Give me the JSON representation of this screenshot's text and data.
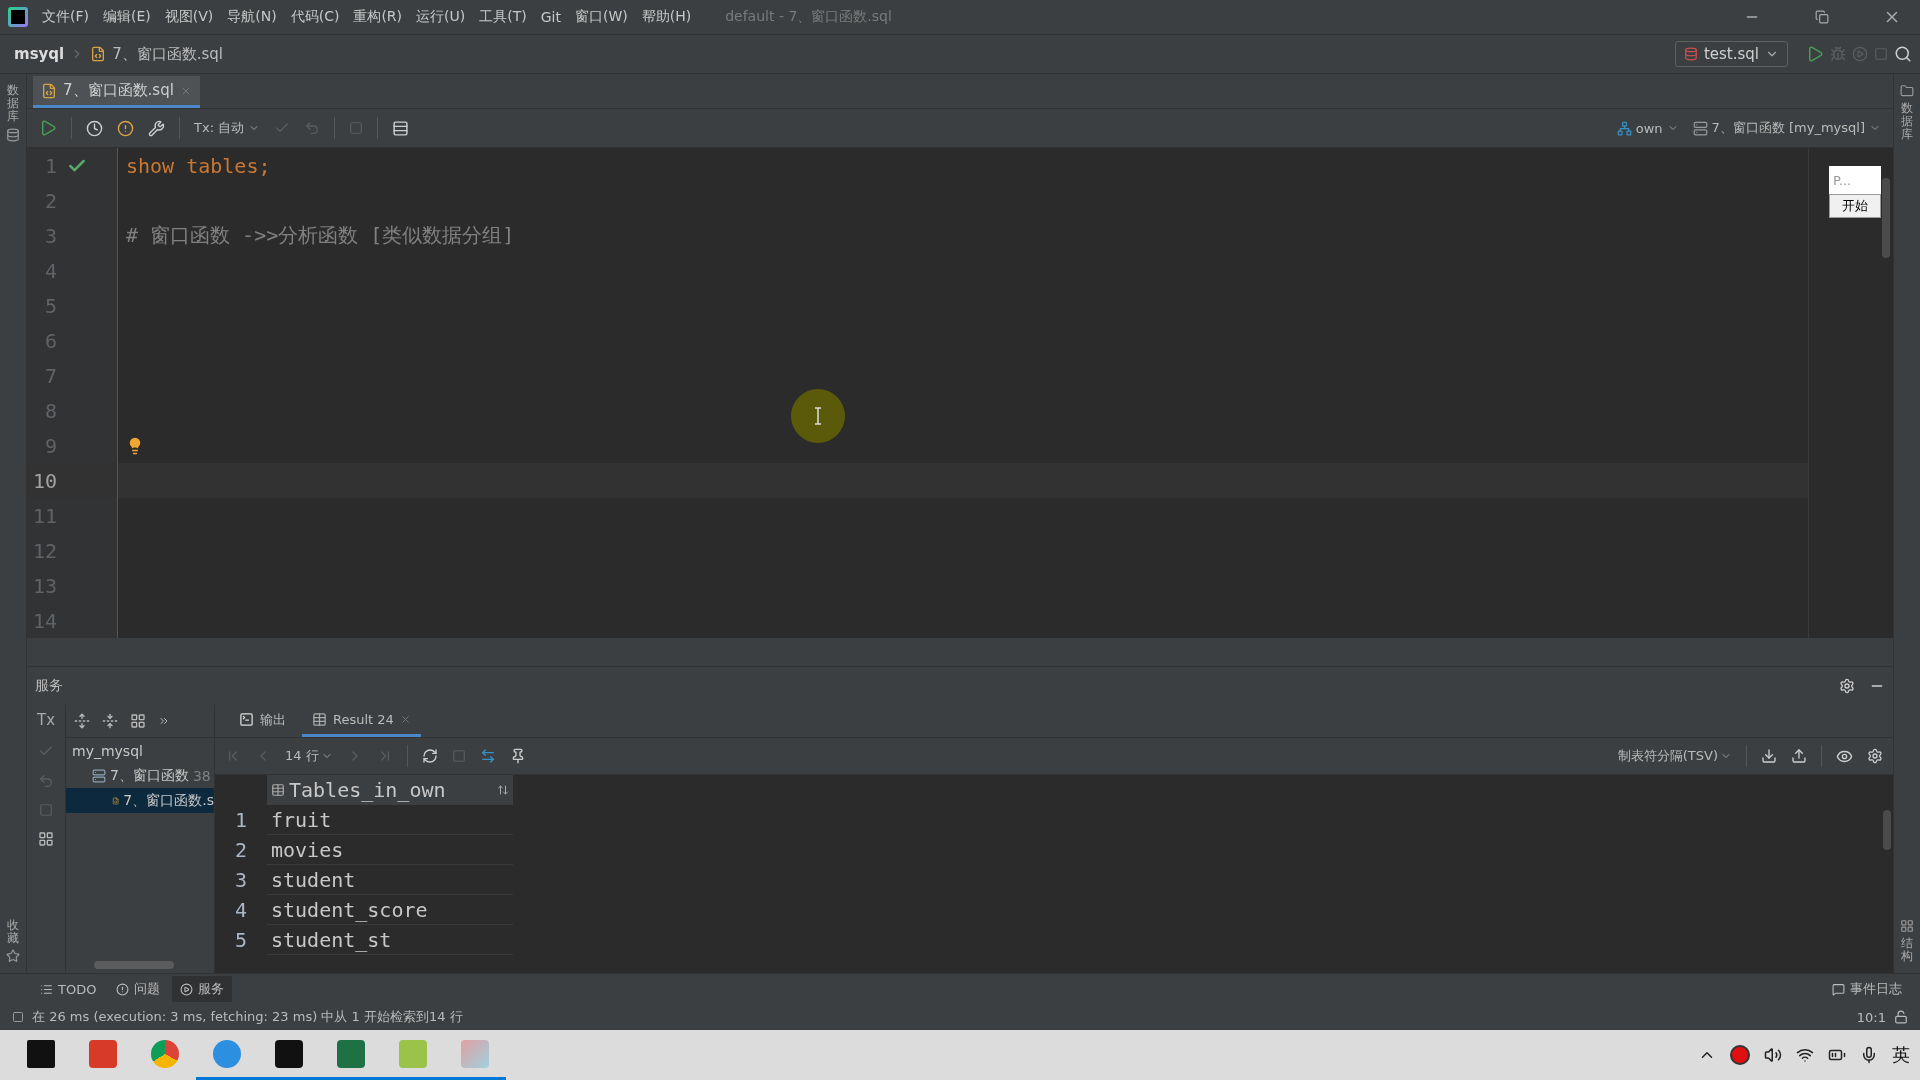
{
  "title_bar": {
    "menu": [
      "文件(F)",
      "编辑(E)",
      "视图(V)",
      "导航(N)",
      "代码(C)",
      "重构(R)",
      "运行(U)",
      "工具(T)",
      "Git",
      "窗口(W)",
      "帮助(H)"
    ],
    "title": "default - 7、窗口函数.sql"
  },
  "nav_bar": {
    "breadcrumb": [
      "msyql",
      "7、窗口函数.sql"
    ],
    "run_config": "test.sql"
  },
  "left_strip": [
    "数据库",
    "收藏"
  ],
  "right_strip": [
    "数据库",
    "结构"
  ],
  "editor_tabs": [
    {
      "label": "7、窗口函数.sql",
      "selected": true
    }
  ],
  "editor_toolbar": {
    "tx_mode": "Tx: 自动",
    "schema": "own",
    "session": "7、窗口函数 [my_mysql]"
  },
  "editor": {
    "lines": [
      {
        "number": "1",
        "kind": "code",
        "text": "show tables;",
        "executed": true,
        "current": false
      },
      {
        "number": "2",
        "kind": "empty",
        "current": false
      },
      {
        "number": "3",
        "kind": "comment",
        "text": "# 窗口函数 ->>分析函数 [类似数据分组]",
        "current": false
      },
      {
        "number": "4",
        "kind": "empty",
        "current": false
      },
      {
        "number": "5",
        "kind": "empty",
        "current": false
      },
      {
        "number": "6",
        "kind": "empty",
        "current": false
      },
      {
        "number": "7",
        "kind": "empty",
        "current": false
      },
      {
        "number": "8",
        "kind": "empty",
        "current": false
      },
      {
        "number": "9",
        "kind": "empty",
        "intention_bulb": true,
        "current": false
      },
      {
        "number": "10",
        "kind": "empty",
        "current": true
      },
      {
        "number": "11",
        "kind": "empty",
        "current": false
      },
      {
        "number": "12",
        "kind": "empty",
        "current": false
      },
      {
        "number": "13",
        "kind": "empty",
        "current": false
      },
      {
        "number": "14",
        "kind": "empty",
        "current": false
      }
    ]
  },
  "floating_widget": {
    "text": "P...",
    "button": "开始"
  },
  "services": {
    "title": "服务",
    "side_label": "Tx",
    "tree": [
      {
        "label": "my_mysql",
        "selected": false,
        "children": [
          {
            "label": "7、窗口函数",
            "extra": "38",
            "selected": false,
            "children": [
              {
                "label": "7、窗口函数.s",
                "selected": true
              }
            ]
          }
        ]
      }
    ],
    "result_tabs": [
      {
        "label": "输出",
        "selected": false
      },
      {
        "label": "Result 24",
        "selected": true
      }
    ],
    "row_count": "14 行",
    "export_format": "制表符分隔(TSV)",
    "table": {
      "column": "Tables_in_own",
      "rows": [
        {
          "number": "1",
          "value": "fruit"
        },
        {
          "number": "2",
          "value": "movies"
        },
        {
          "number": "3",
          "value": "student"
        },
        {
          "number": "4",
          "value": "student_score"
        },
        {
          "number": "5",
          "value": "student_st"
        }
      ]
    }
  },
  "tool_windows": [
    {
      "label": "TODO",
      "selected": false
    },
    {
      "label": "问题",
      "selected": false
    },
    {
      "label": "服务",
      "selected": true
    }
  ],
  "event_log": "事件日志",
  "status_bar": {
    "message": "在 26 ms (execution: 3 ms, fetching: 23 ms) 中从 1 开始检索到14 行",
    "position": "10:1"
  },
  "taskbar": {
    "ime": "英"
  }
}
